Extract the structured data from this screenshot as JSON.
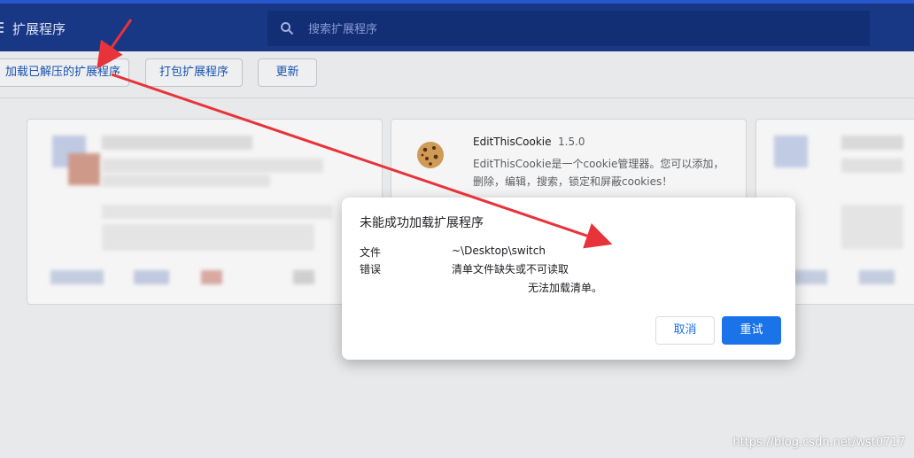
{
  "header": {
    "title": "扩展程序",
    "search_placeholder": "搜索扩展程序"
  },
  "toolbar": {
    "load_unpacked": "加载已解压的扩展程序",
    "pack": "打包扩展程序",
    "update": "更新"
  },
  "extension_card": {
    "name": "EditThisCookie",
    "version": "1.5.0",
    "description": "EditThisCookie是一个cookie管理器。您可以添加，删除，编辑，搜索，锁定和屏蔽cookies！"
  },
  "dialog": {
    "title": "未能成功加载扩展程序",
    "file_label": "文件",
    "file_value": "~\\Desktop\\switch",
    "error_label": "错误",
    "error_value": "清单文件缺失或不可读取",
    "error_extra": "无法加载清单。",
    "cancel": "取消",
    "retry": "重试"
  },
  "watermark": "https://blog.csdn.net/wst0717",
  "colors": {
    "header_bg": "#1a3a8a",
    "accent": "#1a73e8",
    "annotation_arrow": "#e8333a"
  }
}
